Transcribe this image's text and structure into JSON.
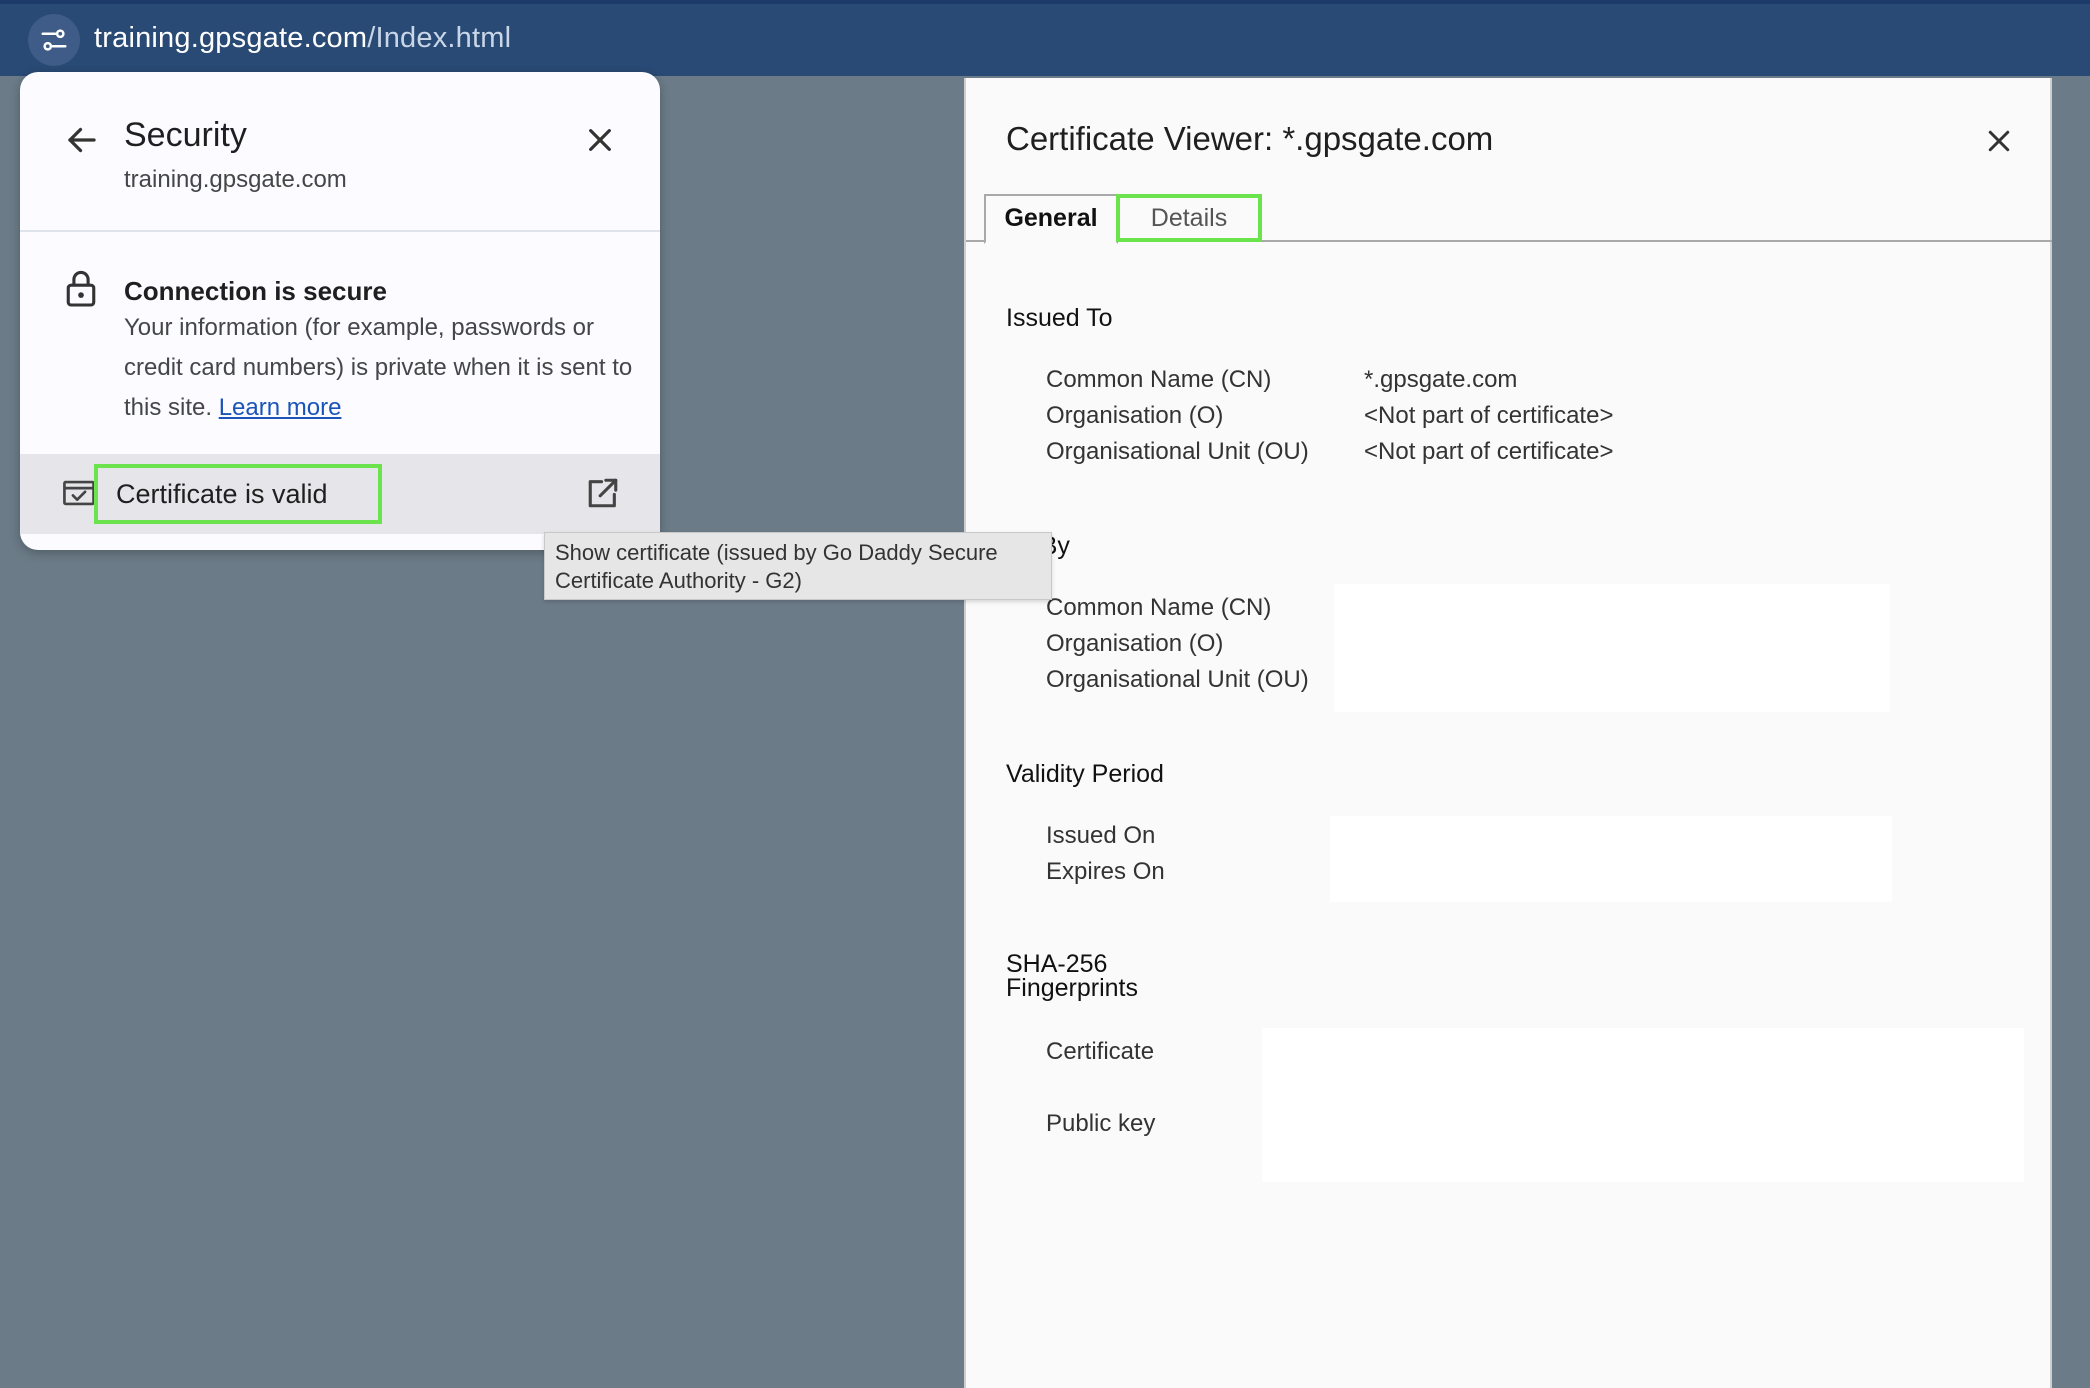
{
  "browser": {
    "url_host": "training.gpsgate.com",
    "url_path": "/Index.html",
    "site_info_icon": "tune-icon"
  },
  "security_popup": {
    "title": "Security",
    "domain": "training.gpsgate.com",
    "back_icon": "arrow-left-icon",
    "close_icon": "close-icon",
    "connection_title": "Connection is secure",
    "connection_desc": "Your information (for example, passwords or credit card numbers) is private when it is sent to this site.",
    "learn_more": "Learn more",
    "certificate_label": "Certificate is valid",
    "certificate_icon": "certificate-check-icon",
    "open_external_icon": "open-external-icon",
    "highlight_color": "#6be34d"
  },
  "tooltip": {
    "text": "Show certificate (issued by Go Daddy Secure Certificate Authority - G2)"
  },
  "viewer": {
    "title": "Certificate Viewer: *.gpsgate.com",
    "tabs": {
      "general": "General",
      "details": "Details"
    },
    "issued_to": {
      "title": "Issued To",
      "cn_label": "Common Name (CN)",
      "cn_value": "*.gpsgate.com",
      "o_label": "Organisation (O)",
      "o_value": "<Not part of certificate>",
      "ou_label": "Organisational Unit (OU)",
      "ou_value": "<Not part of certificate>"
    },
    "issued_by": {
      "title_visible": "ed By",
      "cn_label": "Common Name (CN)",
      "o_label": "Organisation (O)",
      "ou_label": "Organisational Unit (OU)"
    },
    "validity": {
      "title": "Validity Period",
      "issued_on_label": "Issued On",
      "expires_on_label": "Expires On"
    },
    "fingerprints": {
      "title_line1": "SHA-256",
      "title_line2": "Fingerprints",
      "certificate_label": "Certificate",
      "public_key_label": "Public key"
    }
  }
}
